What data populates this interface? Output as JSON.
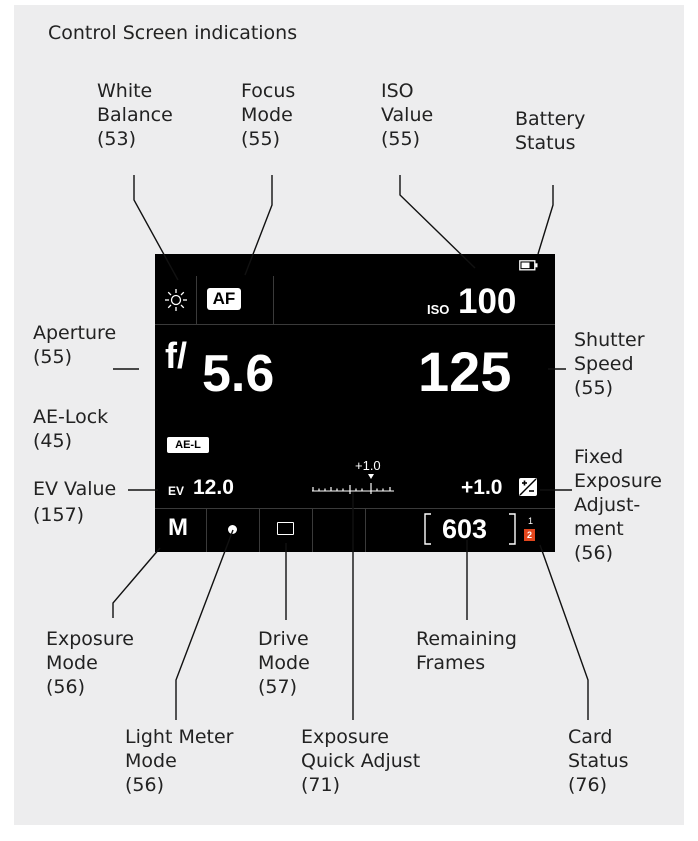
{
  "title": "Control Screen indications",
  "labels": {
    "white_balance": "White\nBalance\n(53)",
    "focus_mode": "Focus\nMode\n(55)",
    "iso_value": "ISO\nValue\n(55)",
    "battery_status": "Battery\nStatus",
    "aperture": "Aperture\n(55)",
    "shutter_speed": "Shutter\nSpeed\n(55)",
    "ae_lock": "AE-Lock\n(45)",
    "ev_value": "EV Value",
    "ev_value_page": "(157)",
    "fixed_exposure": "Fixed\nExposure\nAdjust-\nment\n(56)",
    "exposure_mode": "Exposure\nMode\n(56)",
    "drive_mode": "Drive\nMode\n(57)",
    "remaining_frames": "Remaining\nFrames",
    "light_meter_mode": "Light Meter\nMode\n(56)",
    "exposure_quick_adjust": "Exposure\nQuick Adjust\n(71)",
    "card_status": "Card\nStatus\n(76)"
  },
  "screen": {
    "focus": "AF",
    "iso_prefix": "ISO",
    "iso_value": "100",
    "aperture_prefix": "f/",
    "aperture_value": "5.6",
    "shutter": "125",
    "ae_lock": "AE-L",
    "ev_prefix": "EV",
    "ev_value": "12.0",
    "quick_adjust": "+1.0",
    "fixed_exposure": "+1.0",
    "exposure_mode": "M",
    "remaining_frames": "603",
    "card_top": "1",
    "card_bottom": "2"
  },
  "colors": {
    "screen_bg": "#000000",
    "panel_bg": "#ededee",
    "card_active": "#e2461d"
  }
}
